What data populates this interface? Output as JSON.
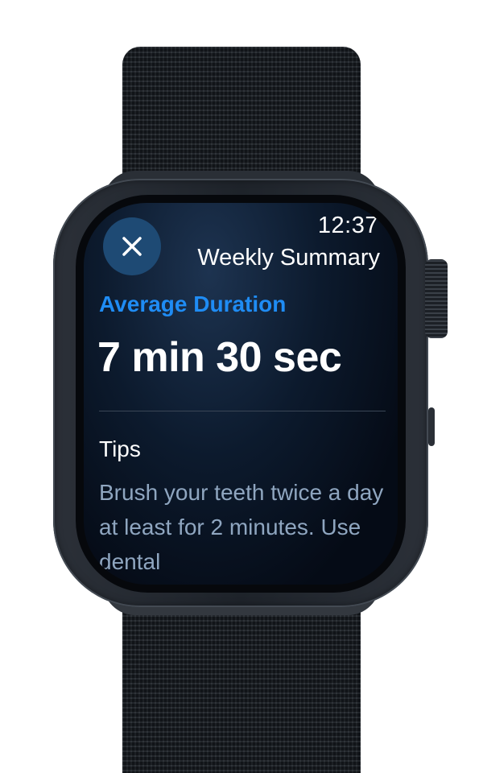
{
  "status_bar": {
    "time": "12:37"
  },
  "navigation": {
    "title": "Weekly Summary",
    "close_icon": "close-icon"
  },
  "summary": {
    "metric_label": "Average Duration",
    "metric_value": "7 min 30 sec"
  },
  "tips": {
    "heading": "Tips",
    "body": "Brush your teeth twice a day at least for 2 minutes. Use dental"
  },
  "colors": {
    "accent": "#1f8cf4",
    "close_button_bg": "#1e4a74",
    "screen_bg": "#0c1a2d",
    "tips_text": "#8fa6c0"
  }
}
